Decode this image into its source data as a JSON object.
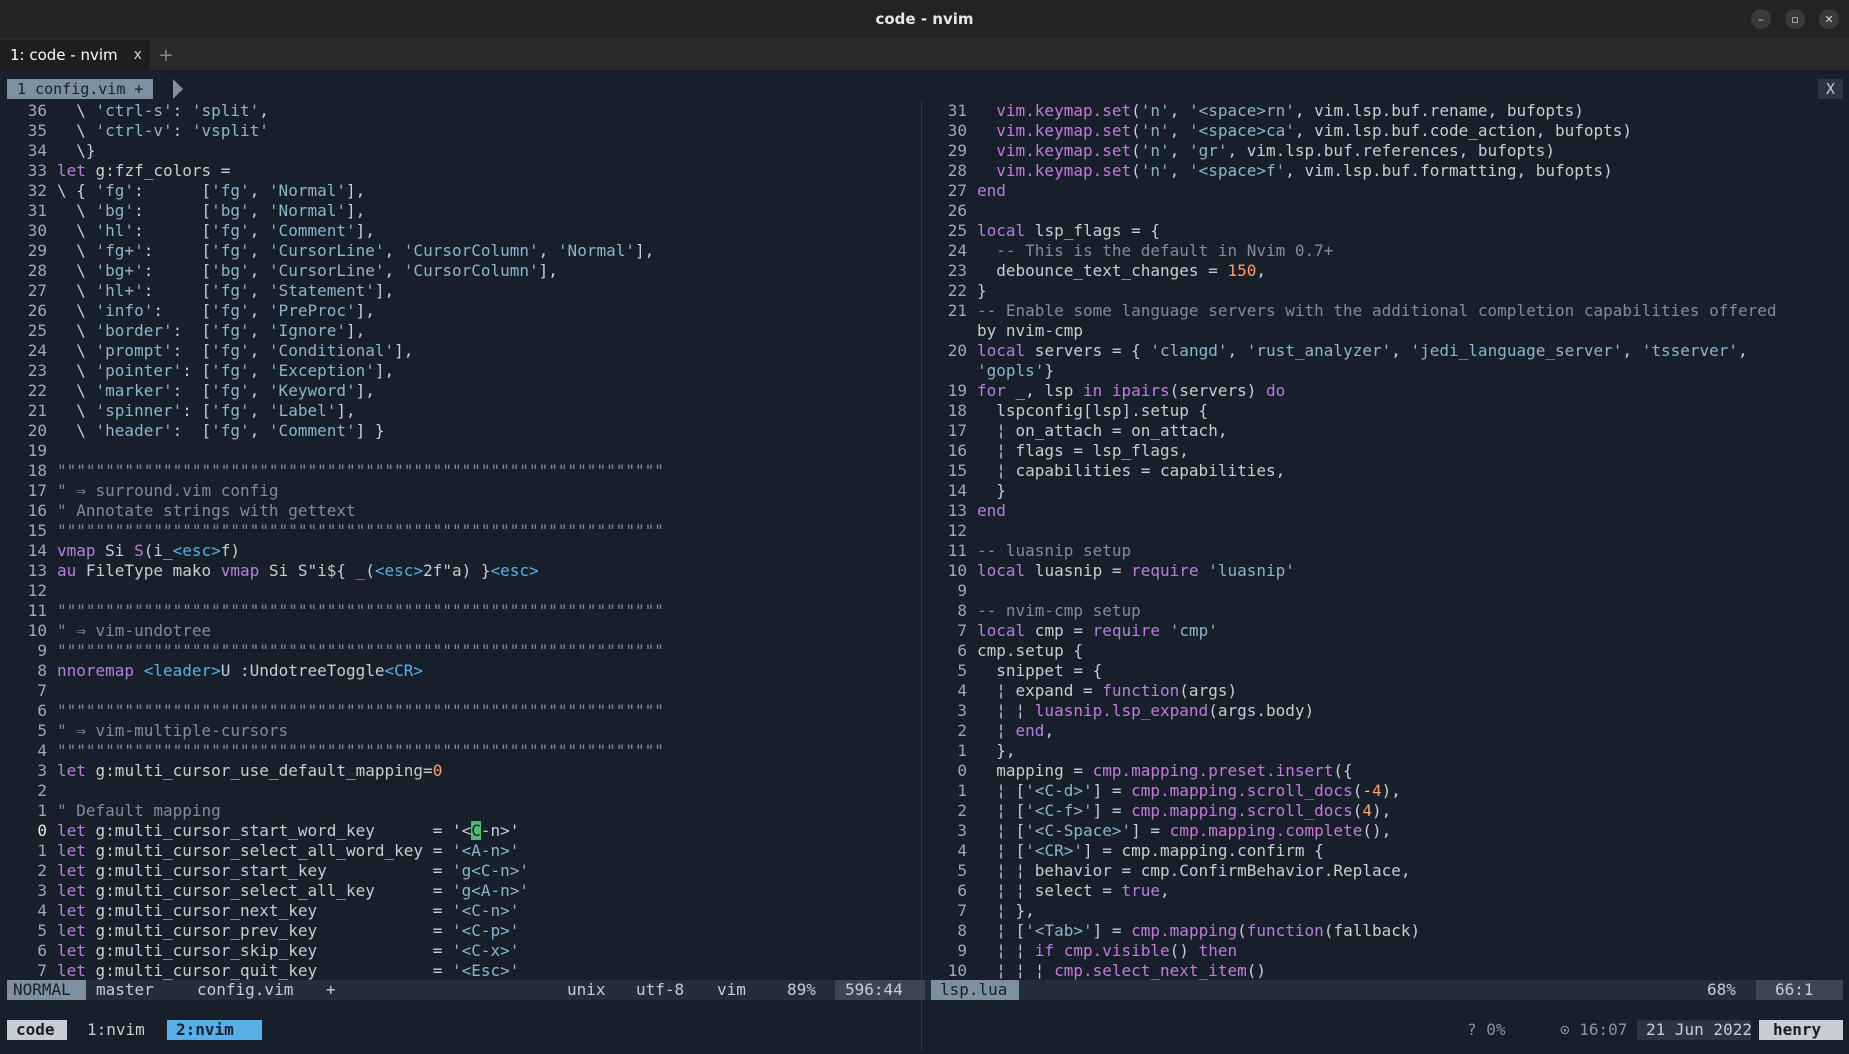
{
  "window": {
    "title": "code - nvim",
    "controls": {
      "minimize": "–",
      "maximize": "▫",
      "close": "✕"
    }
  },
  "tabs": {
    "active_label": "1: code - nvim",
    "close_glyph": "x",
    "new_glyph": "+"
  },
  "buffers": {
    "tab_label": "1 config.vim +",
    "close_label": "X"
  },
  "left_pane": {
    "lines": [
      {
        "n": "36",
        "t": "  \\ 'ctrl-s': 'split',"
      },
      {
        "n": "35",
        "t": "  \\ 'ctrl-v': 'vsplit'"
      },
      {
        "n": "34",
        "t": "  \\}"
      },
      {
        "n": "33",
        "t": "let g:fzf_colors ="
      },
      {
        "n": "32",
        "t": "\\ { 'fg':      ['fg', 'Normal'],"
      },
      {
        "n": "31",
        "t": "  \\ 'bg':      ['bg', 'Normal'],"
      },
      {
        "n": "30",
        "t": "  \\ 'hl':      ['fg', 'Comment'],"
      },
      {
        "n": "29",
        "t": "  \\ 'fg+':     ['fg', 'CursorLine', 'CursorColumn', 'Normal'],"
      },
      {
        "n": "28",
        "t": "  \\ 'bg+':     ['bg', 'CursorLine', 'CursorColumn'],"
      },
      {
        "n": "27",
        "t": "  \\ 'hl+':     ['fg', 'Statement'],"
      },
      {
        "n": "26",
        "t": "  \\ 'info':    ['fg', 'PreProc'],"
      },
      {
        "n": "25",
        "t": "  \\ 'border':  ['fg', 'Ignore'],"
      },
      {
        "n": "24",
        "t": "  \\ 'prompt':  ['fg', 'Conditional'],"
      },
      {
        "n": "23",
        "t": "  \\ 'pointer': ['fg', 'Exception'],"
      },
      {
        "n": "22",
        "t": "  \\ 'marker':  ['fg', 'Keyword'],"
      },
      {
        "n": "21",
        "t": "  \\ 'spinner': ['fg', 'Label'],"
      },
      {
        "n": "20",
        "t": "  \\ 'header':  ['fg', 'Comment'] }"
      },
      {
        "n": "19",
        "t": ""
      },
      {
        "n": "18",
        "t": "\"\"\"\"\"\"\"\"\"\"\"\"\"\"\"\"\"\"\"\"\"\"\"\"\"\"\"\"\"\"\"\"\"\"\"\"\"\"\"\"\"\"\"\"\"\"\"\"\"\"\"\"\"\"\"\"\"\"\"\"\"\"\""
      },
      {
        "n": "17",
        "t": "\" ⇒ surround.vim config"
      },
      {
        "n": "16",
        "t": "\" Annotate strings with gettext"
      },
      {
        "n": "15",
        "t": "\"\"\"\"\"\"\"\"\"\"\"\"\"\"\"\"\"\"\"\"\"\"\"\"\"\"\"\"\"\"\"\"\"\"\"\"\"\"\"\"\"\"\"\"\"\"\"\"\"\"\"\"\"\"\"\"\"\"\"\"\"\"\""
      },
      {
        "n": "14",
        "t": "vmap Si S(i_<esc>f)"
      },
      {
        "n": "13",
        "t": "au FileType mako vmap Si S\"i${ _(<esc>2f\"a) }<esc>"
      },
      {
        "n": "12",
        "t": ""
      },
      {
        "n": "11",
        "t": "\"\"\"\"\"\"\"\"\"\"\"\"\"\"\"\"\"\"\"\"\"\"\"\"\"\"\"\"\"\"\"\"\"\"\"\"\"\"\"\"\"\"\"\"\"\"\"\"\"\"\"\"\"\"\"\"\"\"\"\"\"\"\""
      },
      {
        "n": "10",
        "t": "\" ⇒ vim-undotree"
      },
      {
        "n": "9",
        "t": "\"\"\"\"\"\"\"\"\"\"\"\"\"\"\"\"\"\"\"\"\"\"\"\"\"\"\"\"\"\"\"\"\"\"\"\"\"\"\"\"\"\"\"\"\"\"\"\"\"\"\"\"\"\"\"\"\"\"\"\"\"\"\""
      },
      {
        "n": "8",
        "t": "nnoremap <leader>U :UndotreeToggle<CR>"
      },
      {
        "n": "7",
        "t": ""
      },
      {
        "n": "6",
        "t": "\"\"\"\"\"\"\"\"\"\"\"\"\"\"\"\"\"\"\"\"\"\"\"\"\"\"\"\"\"\"\"\"\"\"\"\"\"\"\"\"\"\"\"\"\"\"\"\"\"\"\"\"\"\"\"\"\"\"\"\"\"\"\""
      },
      {
        "n": "5",
        "t": "\" ⇒ vim-multiple-cursors"
      },
      {
        "n": "4",
        "t": "\"\"\"\"\"\"\"\"\"\"\"\"\"\"\"\"\"\"\"\"\"\"\"\"\"\"\"\"\"\"\"\"\"\"\"\"\"\"\"\"\"\"\"\"\"\"\"\"\"\"\"\"\"\"\"\"\"\"\"\"\"\"\""
      },
      {
        "n": "3",
        "t": "let g:multi_cursor_use_default_mapping=0"
      },
      {
        "n": "2",
        "t": ""
      },
      {
        "n": "1",
        "t": "\" Default mapping"
      },
      {
        "n": "0",
        "t": "let g:multi_cursor_start_word_key      = '<C-n>'",
        "cursor": true
      },
      {
        "n": "1",
        "t": "let g:multi_cursor_select_all_word_key = '<A-n>'"
      },
      {
        "n": "2",
        "t": "let g:multi_cursor_start_key           = 'g<C-n>'"
      },
      {
        "n": "3",
        "t": "let g:multi_cursor_select_all_key      = 'g<A-n>'"
      },
      {
        "n": "4",
        "t": "let g:multi_cursor_next_key            = '<C-n>'"
      },
      {
        "n": "5",
        "t": "let g:multi_cursor_prev_key            = '<C-p>'"
      },
      {
        "n": "6",
        "t": "let g:multi_cursor_skip_key            = '<C-x>'"
      },
      {
        "n": "7",
        "t": "let g:multi_cursor_quit_key            = '<Esc>'"
      }
    ]
  },
  "right_pane": {
    "lines": [
      {
        "n": "31",
        "t": "  vim.keymap.set('n', '<space>rn', vim.lsp.buf.rename, bufopts)"
      },
      {
        "n": "30",
        "t": "  vim.keymap.set('n', '<space>ca', vim.lsp.buf.code_action, bufopts)"
      },
      {
        "n": "29",
        "t": "  vim.keymap.set('n', 'gr', vim.lsp.buf.references, bufopts)"
      },
      {
        "n": "28",
        "t": "  vim.keymap.set('n', '<space>f', vim.lsp.buf.formatting, bufopts)"
      },
      {
        "n": "27",
        "t": "end"
      },
      {
        "n": "26",
        "t": ""
      },
      {
        "n": "25",
        "t": "local lsp_flags = {"
      },
      {
        "n": "24",
        "t": "  -- This is the default in Nvim 0.7+"
      },
      {
        "n": "23",
        "t": "  debounce_text_changes = 150,"
      },
      {
        "n": "22",
        "t": "}"
      },
      {
        "n": "21",
        "t": "-- Enable some language servers with the additional completion capabilities offered"
      },
      {
        "n": "",
        "t": "by nvim-cmp"
      },
      {
        "n": "20",
        "t": "local servers = { 'clangd', 'rust_analyzer', 'jedi_language_server', 'tsserver',"
      },
      {
        "n": "",
        "t": "'gopls'}"
      },
      {
        "n": "19",
        "t": "for _, lsp in ipairs(servers) do"
      },
      {
        "n": "18",
        "t": "  lspconfig[lsp].setup {"
      },
      {
        "n": "17",
        "t": "  ¦ on_attach = on_attach,"
      },
      {
        "n": "16",
        "t": "  ¦ flags = lsp_flags,"
      },
      {
        "n": "15",
        "t": "  ¦ capabilities = capabilities,"
      },
      {
        "n": "14",
        "t": "  }"
      },
      {
        "n": "13",
        "t": "end"
      },
      {
        "n": "12",
        "t": ""
      },
      {
        "n": "11",
        "t": "-- luasnip setup"
      },
      {
        "n": "10",
        "t": "local luasnip = require 'luasnip'"
      },
      {
        "n": "9",
        "t": ""
      },
      {
        "n": "8",
        "t": "-- nvim-cmp setup"
      },
      {
        "n": "7",
        "t": "local cmp = require 'cmp'"
      },
      {
        "n": "6",
        "t": "cmp.setup {"
      },
      {
        "n": "5",
        "t": "  snippet = {"
      },
      {
        "n": "4",
        "t": "  ¦ expand = function(args)"
      },
      {
        "n": "3",
        "t": "  ¦ ¦ luasnip.lsp_expand(args.body)"
      },
      {
        "n": "2",
        "t": "  ¦ end,"
      },
      {
        "n": "1",
        "t": "  },"
      },
      {
        "n": "0",
        "t": "  mapping = cmp.mapping.preset.insert({"
      },
      {
        "n": "1",
        "t": "  ¦ ['<C-d>'] = cmp.mapping.scroll_docs(-4),"
      },
      {
        "n": "2",
        "t": "  ¦ ['<C-f>'] = cmp.mapping.scroll_docs(4),"
      },
      {
        "n": "3",
        "t": "  ¦ ['<C-Space>'] = cmp.mapping.complete(),"
      },
      {
        "n": "4",
        "t": "  ¦ ['<CR>'] = cmp.mapping.confirm {"
      },
      {
        "n": "5",
        "t": "  ¦ ¦ behavior = cmp.ConfirmBehavior.Replace,"
      },
      {
        "n": "6",
        "t": "  ¦ ¦ select = true,"
      },
      {
        "n": "7",
        "t": "  ¦ },"
      },
      {
        "n": "8",
        "t": "  ¦ ['<Tab>'] = cmp.mapping(function(fallback)"
      },
      {
        "n": "9",
        "t": "  ¦ ¦ if cmp.visible() then"
      },
      {
        "n": "10",
        "t": "  ¦ ¦ ¦ cmp.select_next_item()"
      }
    ]
  },
  "statusline": {
    "mode": "NORMAL",
    "git_branch": "master",
    "file": "config.vim",
    "modified": "+",
    "fileformat": "unix",
    "encoding": "utf-8",
    "filetype": "vim",
    "percent": "89%",
    "position": "596:44",
    "right_file": "lsp.lua",
    "right_percent": "68%",
    "right_position": "66:1"
  },
  "tmux": {
    "session": "code",
    "window1": "1:nvim",
    "window2": "2:nvim",
    "help": "? 0%",
    "time": "⊙ 16:07",
    "date": "21 Jun 2022",
    "user": "henry"
  },
  "colors": {
    "background": "#17202a",
    "text": "#c8ccd4",
    "keyword": "#b77ee0",
    "string": "#8fb3c9",
    "comment": "#7f8c98",
    "number": "#ff9e64",
    "builtin": "#e0b553",
    "function": "#c678dd",
    "accent": "#5aaee8",
    "cursor": "#4dbd74"
  }
}
